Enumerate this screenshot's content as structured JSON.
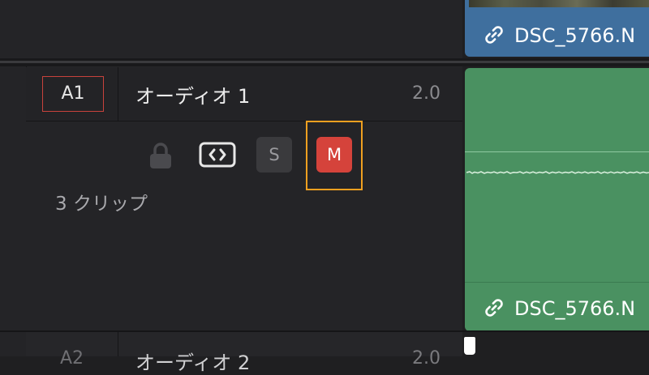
{
  "video_track": {
    "clip_name": "DSC_5766.N",
    "clip_color": "#3f6f9e"
  },
  "audio_track": {
    "id": "A1",
    "name": "オーディオ 1",
    "channel_format": "2.0",
    "clip_count_label": "3 クリップ",
    "solo_label": "S",
    "mute_label": "M",
    "mute_active": true,
    "lock_icon": "lock-icon",
    "link_icon": "auto-select-icon",
    "clip_name": "DSC_5766.N",
    "clip_color": "#4a9161",
    "id_border_color": "#c8423c",
    "mute_color": "#d5433b",
    "highlight_color": "#f0a020"
  },
  "next_track": {
    "id": "A2",
    "name": "オーディオ 2",
    "channel_format": "2.0"
  }
}
